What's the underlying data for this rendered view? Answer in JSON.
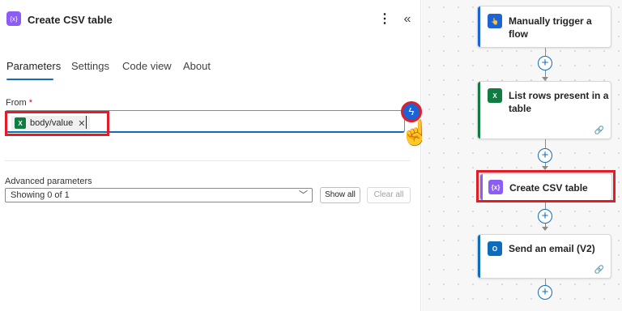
{
  "panel": {
    "title": "Create CSV table",
    "icon_text": "{x}",
    "menu_icon": "more-vertical-icon",
    "collapse_icon": "collapse-left-icon",
    "tabs": [
      {
        "label": "Parameters",
        "active": true
      },
      {
        "label": "Settings",
        "active": false
      },
      {
        "label": "Code view",
        "active": false
      },
      {
        "label": "About",
        "active": false
      }
    ],
    "from": {
      "label": "From",
      "required_mark": "*",
      "token_icon_text": "X",
      "token_text": "body/value",
      "token_remove": "✕"
    },
    "dynamic_content_icon": "lightning-icon",
    "advanced": {
      "label": "Advanced parameters",
      "select_value": "Showing 0 of 1",
      "show_all": "Show all",
      "clear_all": "Clear all"
    }
  },
  "flow": {
    "steps": [
      {
        "title": "Manually trigger a flow",
        "icon": "touch-icon",
        "icon_text": "👆",
        "accent": "#1c63d5"
      },
      {
        "title": "List rows present in a table",
        "icon": "excel-icon",
        "icon_text": "X",
        "accent": "#107c41"
      },
      {
        "title": "Create CSV table",
        "icon": "data-operation-icon",
        "icon_text": "{x}",
        "accent": "#8b5cf6"
      },
      {
        "title": "Send an email (V2)",
        "icon": "outlook-icon",
        "icon_text": "O",
        "accent": "#0f6cbd"
      }
    ]
  },
  "colors": {
    "accent_blue": "#0f6cbd",
    "highlight_red": "#e11d2a",
    "excel_green": "#107c41",
    "data_op_purple": "#8b5cf6"
  }
}
